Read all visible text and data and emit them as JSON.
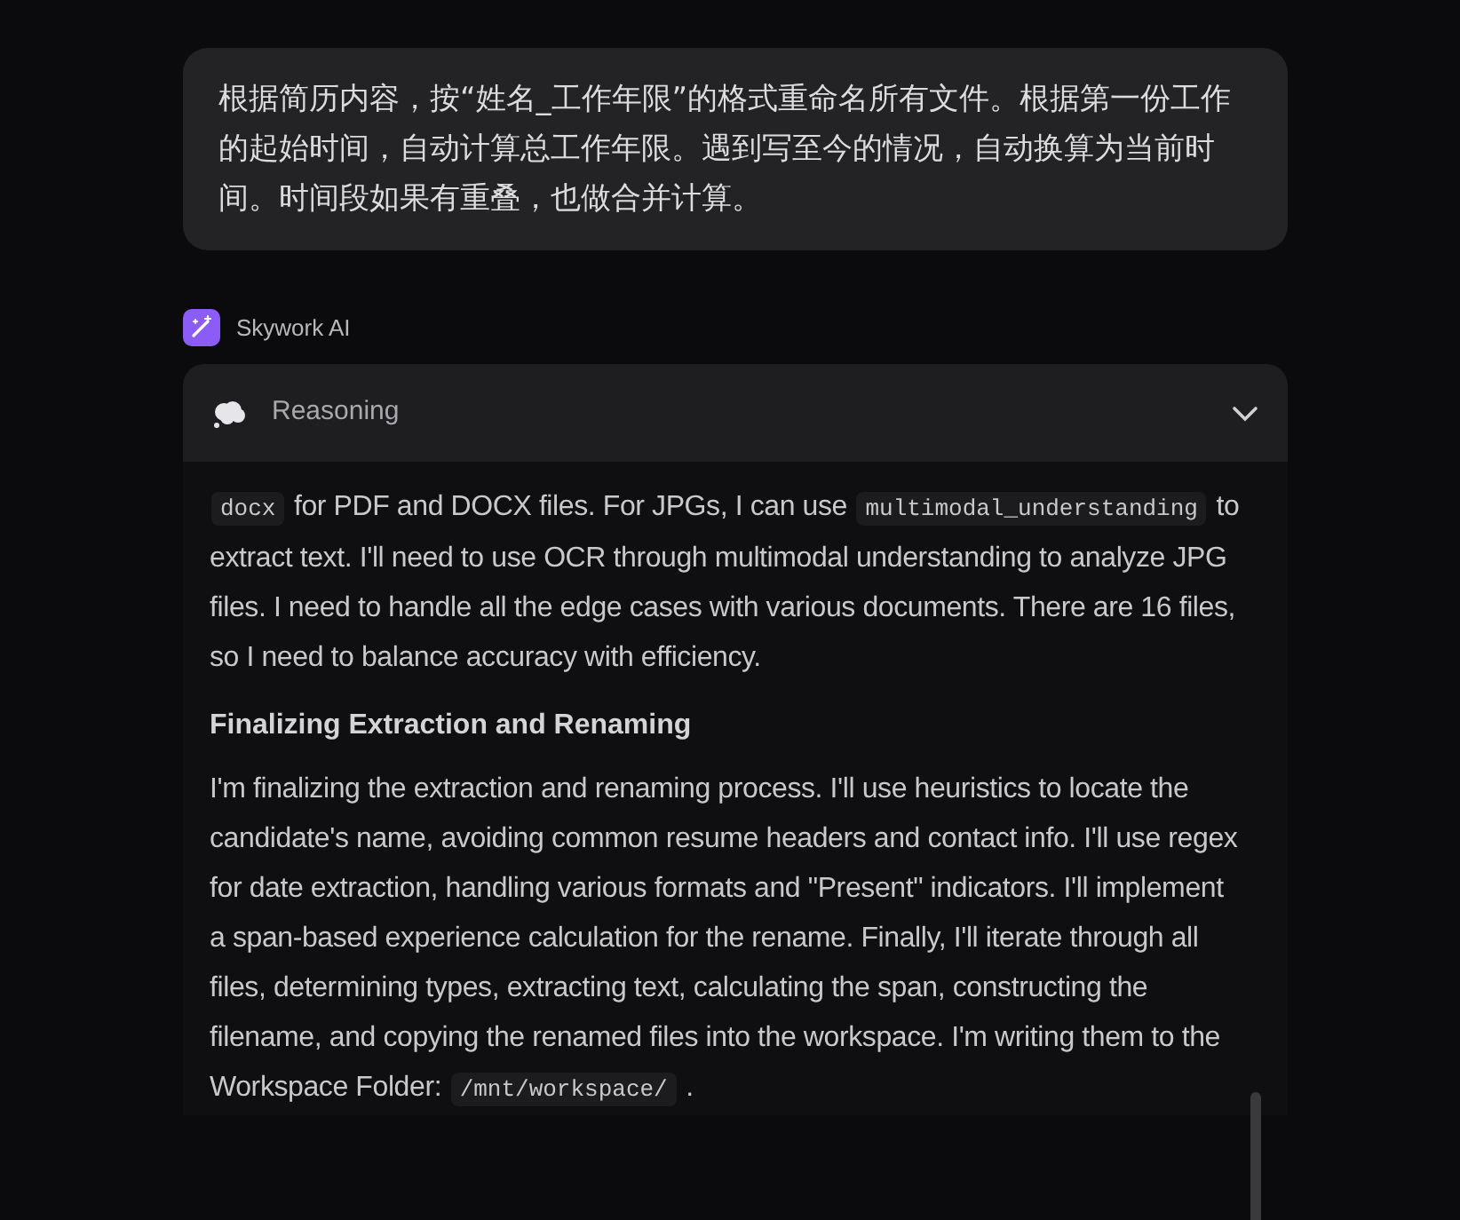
{
  "user_message": "根据简历内容，按“姓名_工作年限”的格式重命名所有文件。根据第一份工作的起始时间，自动计算总工作年限。遇到写至今的情况，自动换算为当前时间。时间段如果有重叠，也做合并计算。",
  "assistant": {
    "name": "Skywork AI"
  },
  "reasoning": {
    "title": "Reasoning",
    "expanded": true,
    "blocks": [
      {
        "kind": "paragraph",
        "segments": [
          {
            "kind": "code",
            "text": "docx"
          },
          {
            "kind": "text",
            "text": " for PDF and DOCX files. For JPGs, I can use "
          },
          {
            "kind": "code",
            "text": "multimodal_understanding"
          },
          {
            "kind": "text",
            "text": " to extract text. I'll need to use OCR through multimodal understanding to analyze JPG files. I need to handle all the edge cases with various documents. There are 16 files, so I need to balance accuracy with efficiency."
          }
        ]
      },
      {
        "kind": "heading",
        "segments": [
          {
            "kind": "text",
            "text": "Finalizing Extraction and Renaming"
          }
        ]
      },
      {
        "kind": "paragraph",
        "segments": [
          {
            "kind": "text",
            "text": "I'm finalizing the extraction and renaming process. I'll use heuristics to locate the candidate's name, avoiding common resume headers and contact info. I'll use regex for date extraction, handling various formats and \"Present\" indicators. I'll implement a span-based experience calculation for the rename. Finally, I'll iterate through all files, determining types, extracting text, calculating the span, constructing the filename, and copying the renamed files into the workspace. I'm writing them to the Workspace Folder: "
          },
          {
            "kind": "code",
            "text": "/mnt/workspace/"
          },
          {
            "kind": "text",
            "text": " ."
          }
        ]
      }
    ]
  }
}
